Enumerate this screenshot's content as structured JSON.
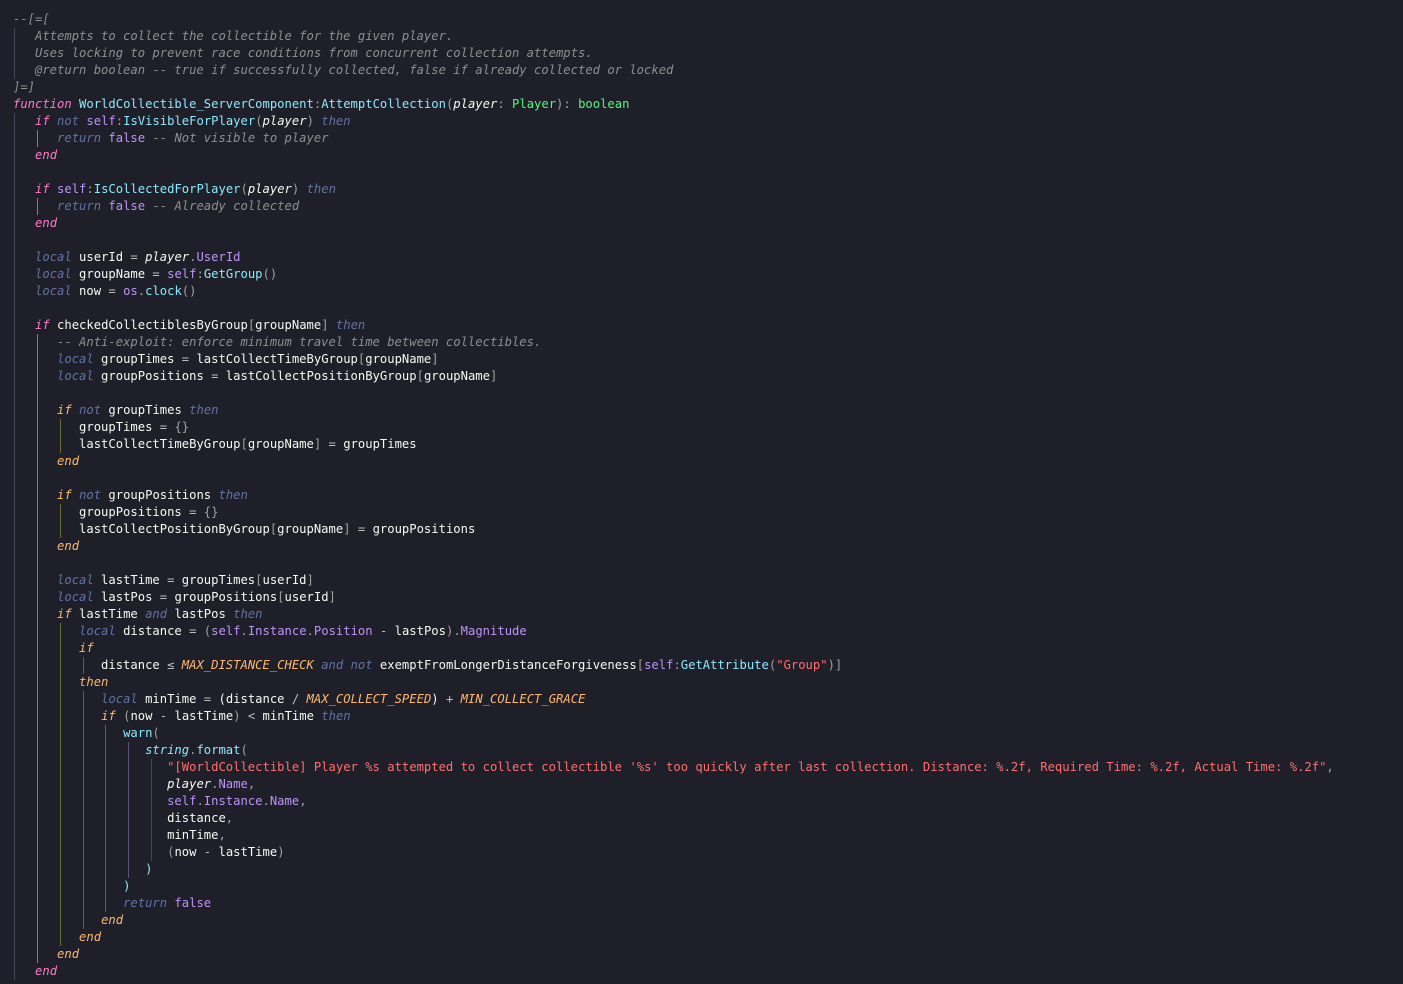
{
  "editor": {
    "background": "#1e1f29",
    "guide_colors": [
      "#44475a",
      "#8a8a3a",
      "#6b6b3a",
      "#4d6b45",
      "#2f6f80",
      "#5b4d7a"
    ],
    "lines": [
      [
        [
          "--[=[",
          "comment"
        ]
      ],
      [
        [
          "   Attempts to collect the collectible for the given player.",
          "comment"
        ]
      ],
      [
        [
          "   Uses locking to prevent race conditions from concurrent collection attempts.",
          "comment"
        ]
      ],
      [
        [
          "   @return boolean -- true if successfully collected, false if already collected or locked",
          "comment"
        ]
      ],
      [
        [
          "]=]",
          "comment"
        ]
      ],
      [
        [
          "function",
          "kw"
        ],
        [
          " ",
          "ident"
        ],
        [
          "WorldCollectible_ServerComponent",
          "func-decl"
        ],
        [
          ":",
          "punct"
        ],
        [
          "AttemptCollection",
          "func-decl"
        ],
        [
          "(",
          "punct"
        ],
        [
          "player",
          "param"
        ],
        [
          ": ",
          "punct"
        ],
        [
          "Player",
          "type"
        ],
        [
          "): ",
          "punct"
        ],
        [
          "boolean",
          "type"
        ]
      ],
      [
        [
          "   ",
          "ident"
        ],
        [
          "if",
          "kw"
        ],
        [
          " ",
          "ident"
        ],
        [
          "not",
          "not"
        ],
        [
          " ",
          "ident"
        ],
        [
          "self",
          "self"
        ],
        [
          ":",
          "punct"
        ],
        [
          "IsVisibleForPlayer",
          "func"
        ],
        [
          "(",
          "punct"
        ],
        [
          "player",
          "param"
        ],
        [
          ")",
          "punct"
        ],
        [
          " ",
          "ident"
        ],
        [
          "then",
          "then"
        ]
      ],
      [
        [
          "      ",
          "ident"
        ],
        [
          "return",
          "ret"
        ],
        [
          " false ",
          "bool"
        ],
        [
          "-- Not visible to player",
          "comment"
        ]
      ],
      [
        [
          "   ",
          "ident"
        ],
        [
          "end",
          "end"
        ]
      ],
      [
        [
          "",
          "ident"
        ]
      ],
      [
        [
          "   ",
          "ident"
        ],
        [
          "if",
          "kw"
        ],
        [
          " ",
          "ident"
        ],
        [
          "self",
          "self"
        ],
        [
          ":",
          "punct"
        ],
        [
          "IsCollectedForPlayer",
          "func"
        ],
        [
          "(",
          "punct"
        ],
        [
          "player",
          "param"
        ],
        [
          ")",
          "punct"
        ],
        [
          " ",
          "ident"
        ],
        [
          "then",
          "then"
        ]
      ],
      [
        [
          "      ",
          "ident"
        ],
        [
          "return",
          "ret"
        ],
        [
          " false ",
          "bool"
        ],
        [
          "-- Already collected",
          "comment"
        ]
      ],
      [
        [
          "   ",
          "ident"
        ],
        [
          "end",
          "end"
        ]
      ],
      [
        [
          "",
          "ident"
        ]
      ],
      [
        [
          "   ",
          "ident"
        ],
        [
          "local",
          "local"
        ],
        [
          " userId ",
          "ident"
        ],
        [
          "=",
          "op"
        ],
        [
          " ",
          "ident"
        ],
        [
          "player",
          "param"
        ],
        [
          ".",
          "punct"
        ],
        [
          "UserId",
          "prop"
        ]
      ],
      [
        [
          "   ",
          "ident"
        ],
        [
          "local",
          "local"
        ],
        [
          " groupName ",
          "ident"
        ],
        [
          "=",
          "op"
        ],
        [
          " ",
          "ident"
        ],
        [
          "self",
          "self"
        ],
        [
          ":",
          "punct"
        ],
        [
          "GetGroup",
          "func"
        ],
        [
          "()",
          "punct"
        ]
      ],
      [
        [
          "   ",
          "ident"
        ],
        [
          "local",
          "local"
        ],
        [
          " now ",
          "ident"
        ],
        [
          "=",
          "op"
        ],
        [
          " ",
          "ident"
        ],
        [
          "os",
          "lib"
        ],
        [
          ".",
          "punct"
        ],
        [
          "clock",
          "func"
        ],
        [
          "()",
          "punct"
        ]
      ],
      [
        [
          "",
          "ident"
        ]
      ],
      [
        [
          "   ",
          "ident"
        ],
        [
          "if",
          "kw"
        ],
        [
          " checkedCollectiblesByGroup",
          "ident"
        ],
        [
          "[",
          "punct"
        ],
        [
          "groupName",
          "ident"
        ],
        [
          "]",
          "punct"
        ],
        [
          " ",
          "ident"
        ],
        [
          "then",
          "then"
        ]
      ],
      [
        [
          "      ",
          "ident"
        ],
        [
          "-- Anti-exploit: enforce minimum travel time between collectibles.",
          "comment"
        ]
      ],
      [
        [
          "      ",
          "ident"
        ],
        [
          "local",
          "local"
        ],
        [
          " groupTimes ",
          "ident"
        ],
        [
          "=",
          "op"
        ],
        [
          " lastCollectTimeByGroup",
          "ident"
        ],
        [
          "[",
          "punct"
        ],
        [
          "groupName",
          "ident"
        ],
        [
          "]",
          "punct"
        ]
      ],
      [
        [
          "      ",
          "ident"
        ],
        [
          "local",
          "local"
        ],
        [
          " groupPositions ",
          "ident"
        ],
        [
          "=",
          "op"
        ],
        [
          " lastCollectPositionByGroup",
          "ident"
        ],
        [
          "[",
          "punct"
        ],
        [
          "groupName",
          "ident"
        ],
        [
          "]",
          "punct"
        ]
      ],
      [
        [
          "",
          "ident"
        ]
      ],
      [
        [
          "      ",
          "ident"
        ],
        [
          "if",
          "ctl"
        ],
        [
          " ",
          "ident"
        ],
        [
          "not",
          "not"
        ],
        [
          " groupTimes ",
          "ident"
        ],
        [
          "then",
          "then"
        ]
      ],
      [
        [
          "         groupTimes ",
          "ident"
        ],
        [
          "=",
          "op"
        ],
        [
          " ",
          "ident"
        ],
        [
          "{}",
          "punct"
        ]
      ],
      [
        [
          "         lastCollectTimeByGroup",
          "ident"
        ],
        [
          "[",
          "punct"
        ],
        [
          "groupName",
          "ident"
        ],
        [
          "]",
          "punct"
        ],
        [
          " ",
          "ident"
        ],
        [
          "=",
          "op"
        ],
        [
          " groupTimes",
          "ident"
        ]
      ],
      [
        [
          "      ",
          "ident"
        ],
        [
          "end",
          "ctl"
        ]
      ],
      [
        [
          "",
          "ident"
        ]
      ],
      [
        [
          "      ",
          "ident"
        ],
        [
          "if",
          "ctl"
        ],
        [
          " ",
          "ident"
        ],
        [
          "not",
          "not"
        ],
        [
          " groupPositions ",
          "ident"
        ],
        [
          "then",
          "then"
        ]
      ],
      [
        [
          "         groupPositions ",
          "ident"
        ],
        [
          "=",
          "op"
        ],
        [
          " ",
          "ident"
        ],
        [
          "{}",
          "punct"
        ]
      ],
      [
        [
          "         lastCollectPositionByGroup",
          "ident"
        ],
        [
          "[",
          "punct"
        ],
        [
          "groupName",
          "ident"
        ],
        [
          "]",
          "punct"
        ],
        [
          " ",
          "ident"
        ],
        [
          "=",
          "op"
        ],
        [
          " groupPositions",
          "ident"
        ]
      ],
      [
        [
          "      ",
          "ident"
        ],
        [
          "end",
          "ctl"
        ]
      ],
      [
        [
          "",
          "ident"
        ]
      ],
      [
        [
          "      ",
          "ident"
        ],
        [
          "local",
          "local"
        ],
        [
          " lastTime ",
          "ident"
        ],
        [
          "=",
          "op"
        ],
        [
          " groupTimes",
          "ident"
        ],
        [
          "[",
          "punct"
        ],
        [
          "userId",
          "ident"
        ],
        [
          "]",
          "punct"
        ]
      ],
      [
        [
          "      ",
          "ident"
        ],
        [
          "local",
          "local"
        ],
        [
          " lastPos ",
          "ident"
        ],
        [
          "=",
          "op"
        ],
        [
          " groupPositions",
          "ident"
        ],
        [
          "[",
          "punct"
        ],
        [
          "userId",
          "ident"
        ],
        [
          "]",
          "punct"
        ]
      ],
      [
        [
          "      ",
          "ident"
        ],
        [
          "if",
          "ctl"
        ],
        [
          " lastTime ",
          "ident"
        ],
        [
          "and",
          "not"
        ],
        [
          " lastPos ",
          "ident"
        ],
        [
          "then",
          "then"
        ]
      ],
      [
        [
          "         ",
          "ident"
        ],
        [
          "local",
          "local"
        ],
        [
          " distance ",
          "ident"
        ],
        [
          "=",
          "op"
        ],
        [
          " ",
          "ident"
        ],
        [
          "(",
          "punct"
        ],
        [
          "self",
          "self"
        ],
        [
          ".",
          "punct"
        ],
        [
          "Instance",
          "prop"
        ],
        [
          ".",
          "punct"
        ],
        [
          "Position",
          "prop"
        ],
        [
          " - ",
          "op"
        ],
        [
          "lastPos",
          "ident"
        ],
        [
          ")",
          "punct"
        ],
        [
          ".",
          "punct"
        ],
        [
          "Magnitude",
          "prop"
        ]
      ],
      [
        [
          "         ",
          "ident"
        ],
        [
          "if",
          "ctl"
        ]
      ],
      [
        [
          "            distance ",
          "ident"
        ],
        [
          "≤",
          "op"
        ],
        [
          " ",
          "ident"
        ],
        [
          "MAX_DISTANCE_CHECK",
          "const"
        ],
        [
          " ",
          "ident"
        ],
        [
          "and",
          "not"
        ],
        [
          " ",
          "ident"
        ],
        [
          "not",
          "not"
        ],
        [
          " exemptFromLongerDistanceForgiveness",
          "ident"
        ],
        [
          "[",
          "punct"
        ],
        [
          "self",
          "self"
        ],
        [
          ":",
          "punct"
        ],
        [
          "GetAttribute",
          "func"
        ],
        [
          "(",
          "punct"
        ],
        [
          "\"Group\"",
          "str"
        ],
        [
          ")",
          "punct"
        ],
        [
          "]",
          "punct"
        ]
      ],
      [
        [
          "         ",
          "ident"
        ],
        [
          "then",
          "ctl"
        ]
      ],
      [
        [
          "            ",
          "ident"
        ],
        [
          "local",
          "local"
        ],
        [
          " minTime ",
          "ident"
        ],
        [
          "=",
          "op"
        ],
        [
          " (distance ",
          "ident"
        ],
        [
          "/",
          "op"
        ],
        [
          " ",
          "ident"
        ],
        [
          "MAX_COLLECT_SPEED",
          "const"
        ],
        [
          ") ",
          "ident"
        ],
        [
          "+",
          "op"
        ],
        [
          " ",
          "ident"
        ],
        [
          "MIN_COLLECT_GRACE",
          "const"
        ]
      ],
      [
        [
          "            ",
          "ident"
        ],
        [
          "if",
          "ctl"
        ],
        [
          " ",
          "ident"
        ],
        [
          "(",
          "punct"
        ],
        [
          "now ",
          "ident"
        ],
        [
          "-",
          "op"
        ],
        [
          " lastTime",
          "ident"
        ],
        [
          ")",
          "punct"
        ],
        [
          " ",
          "ident"
        ],
        [
          "<",
          "op"
        ],
        [
          " minTime ",
          "ident"
        ],
        [
          "then",
          "then"
        ]
      ],
      [
        [
          "               ",
          "ident"
        ],
        [
          "warn",
          "func"
        ],
        [
          "(",
          "punct"
        ]
      ],
      [
        [
          "                  ",
          "ident"
        ],
        [
          "string",
          "builtin"
        ],
        [
          ".",
          "punct"
        ],
        [
          "format",
          "func"
        ],
        [
          "(",
          "punct"
        ]
      ],
      [
        [
          "                     ",
          "ident"
        ],
        [
          "\"[WorldCollectible] Player %s attempted to collect collectible '%s' too quickly after last collection. Distance: %.2f, Required Time: %.2f, Actual Time: %.2f\"",
          "str"
        ],
        [
          ",",
          "punct"
        ]
      ],
      [
        [
          "                     ",
          "ident"
        ],
        [
          "player",
          "param"
        ],
        [
          ".",
          "punct"
        ],
        [
          "Name",
          "prop"
        ],
        [
          ",",
          "punct"
        ]
      ],
      [
        [
          "                     ",
          "ident"
        ],
        [
          "self",
          "self"
        ],
        [
          ".",
          "punct"
        ],
        [
          "Instance",
          "prop"
        ],
        [
          ".",
          "punct"
        ],
        [
          "Name",
          "prop"
        ],
        [
          ",",
          "punct"
        ]
      ],
      [
        [
          "                     distance",
          "ident"
        ],
        [
          ",",
          "punct"
        ]
      ],
      [
        [
          "                     minTime",
          "ident"
        ],
        [
          ",",
          "punct"
        ]
      ],
      [
        [
          "                     ",
          "ident"
        ],
        [
          "(",
          "punct"
        ],
        [
          "now ",
          "ident"
        ],
        [
          "-",
          "op"
        ],
        [
          " lastTime",
          "ident"
        ],
        [
          ")",
          "punct"
        ]
      ],
      [
        [
          "                  ",
          "ident"
        ],
        [
          ")",
          "func"
        ]
      ],
      [
        [
          "               ",
          "ident"
        ],
        [
          ")",
          "func"
        ]
      ],
      [
        [
          "               ",
          "ident"
        ],
        [
          "return",
          "ret"
        ],
        [
          " false",
          "bool"
        ]
      ],
      [
        [
          "            ",
          "ident"
        ],
        [
          "end",
          "ctl"
        ]
      ],
      [
        [
          "         ",
          "ident"
        ],
        [
          "end",
          "ctl"
        ]
      ],
      [
        [
          "      ",
          "ident"
        ],
        [
          "end",
          "ctl"
        ]
      ],
      [
        [
          "   ",
          "ident"
        ],
        [
          "end",
          "end"
        ]
      ]
    ]
  }
}
